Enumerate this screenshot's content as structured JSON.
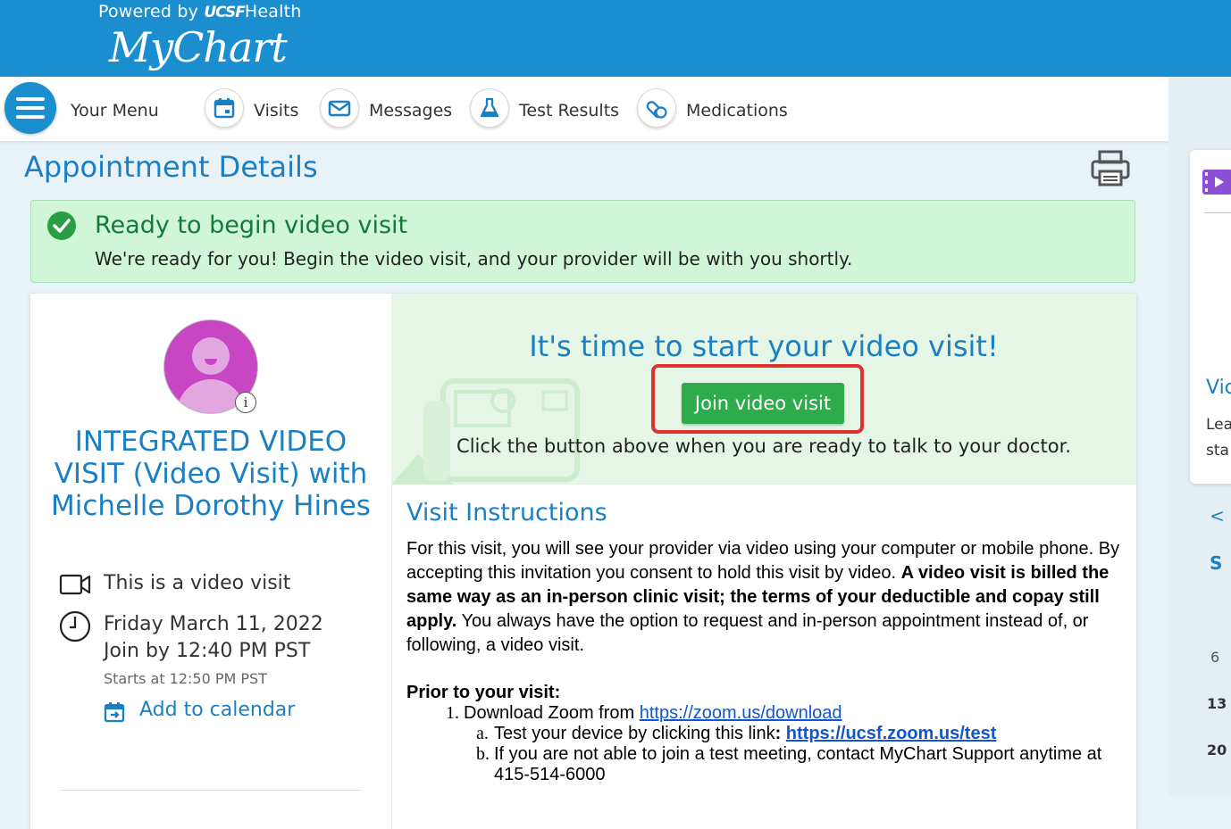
{
  "header": {
    "powered_prefix": "Powered by",
    "powered_brand": "UCSF",
    "powered_suffix": "Health",
    "logo": "MyChart"
  },
  "menu": {
    "toggle_label": "Your Menu",
    "items": [
      {
        "label": "Visits",
        "icon": "calendar-icon"
      },
      {
        "label": "Messages",
        "icon": "envelope-icon"
      },
      {
        "label": "Test Results",
        "icon": "flask-icon"
      },
      {
        "label": "Medications",
        "icon": "pills-icon"
      }
    ]
  },
  "page": {
    "title": "Appointment Details"
  },
  "banner": {
    "title": "Ready to begin video visit",
    "text": "We're ready for you! Begin the video visit, and your provider will be with you shortly."
  },
  "appointment": {
    "title": "INTEGRATED VIDEO VISIT (Video Visit) with Michelle Dorothy Hines",
    "type_text": "This is a video visit",
    "date": "Friday March 11, 2022",
    "join_by": "Join by 12:40 PM PST",
    "starts_at": "Starts at 12:50 PM PST",
    "add_to_calendar": "Add to calendar"
  },
  "video": {
    "heading": "It's time to start your video visit!",
    "join_label": "Join video visit",
    "subtext": "Click the button above when you are ready to talk to your doctor."
  },
  "instructions": {
    "title": "Visit Instructions",
    "para_start": "For this visit, you will see your provider via video using your computer or mobile phone.  By accepting this invitation you consent to hold this visit by video. ",
    "para_bold": " A video visit is billed the same way as an in-person clinic visit; the terms of your deductible and copay still apply.",
    "para_end": "  You always have the option to request and in-person appointment instead of, or following, a video visit.",
    "prior_heading": "Prior to your visit:",
    "step1_num": "1.",
    "step1_text": "Download Zoom from ",
    "step1_link": "https://zoom.us/download",
    "sub_a_num": "a.",
    "sub_a_text": "Test your device by clicking this link",
    "sub_a_colon": ": ",
    "sub_a_link": "https://ucsf.zoom.us/test",
    "sub_b_num": "b.",
    "sub_b_text": "If you are not able to join a test meeting, contact MyChart Support anytime at 415-514-6000"
  },
  "sidebar_peek": {
    "title": "Vic",
    "line1": "Lea",
    "line2": "sta",
    "cal_prev": "<",
    "cal_day_header": "S",
    "cal_days": [
      "6",
      "13",
      "20"
    ]
  },
  "colors": {
    "brand_blue": "#1b8ecf",
    "link_blue": "#1b7fc4",
    "success_green": "#2eab4a",
    "banner_bg": "#d0f6d7",
    "highlight_red": "#e03131",
    "avatar_magenta": "#c845c4"
  }
}
